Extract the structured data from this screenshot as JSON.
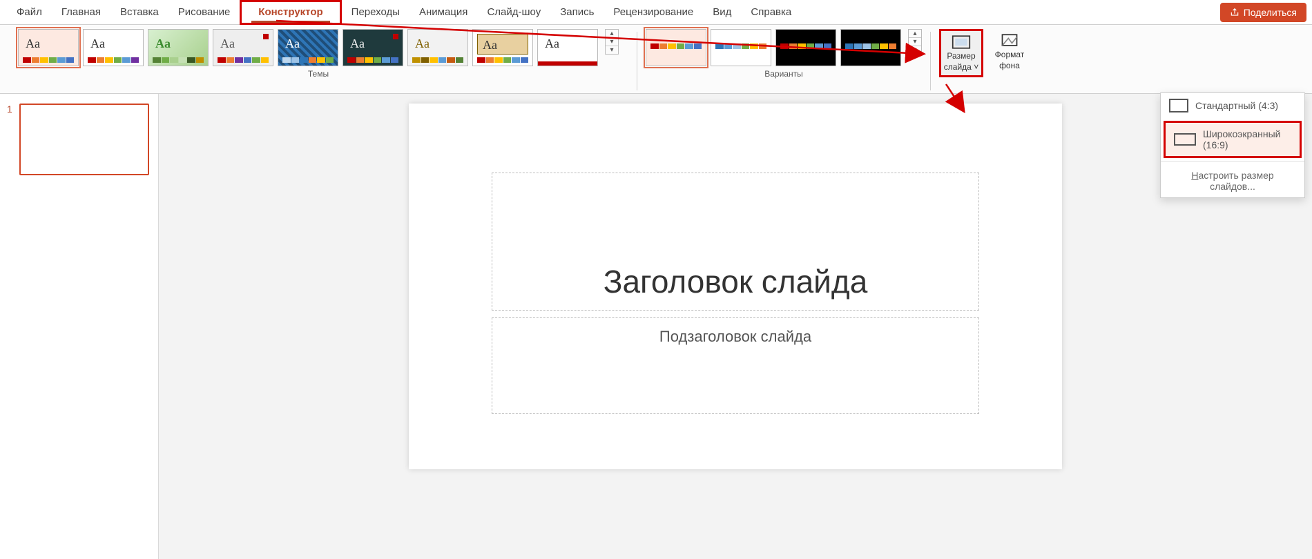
{
  "tabs": {
    "file": "Файл",
    "home": "Главная",
    "insert": "Вставка",
    "draw": "Рисование",
    "design": "Конструктор",
    "transitions": "Переходы",
    "animations": "Анимация",
    "slideshow": "Слайд-шоу",
    "record": "Запись",
    "review": "Рецензирование",
    "view": "Вид",
    "help": "Справка"
  },
  "share_label": "Поделиться",
  "ribbon": {
    "themes_label": "Темы",
    "variants_label": "Варианты",
    "slide_size_label_line1": "Размер",
    "slide_size_label_line2": "слайда",
    "format_bg_line1": "Формат",
    "format_bg_line2": "фона",
    "theme_sample_text": "Aa"
  },
  "menu": {
    "standard": "Стандартный (4:3)",
    "wide": "Широкоэкранный (16:9)",
    "custom_prefix": "Н",
    "custom_rest": "астроить размер слайдов..."
  },
  "thumbs": {
    "slide1_number": "1"
  },
  "slide": {
    "title_placeholder": "Заголовок слайда",
    "subtitle_placeholder": "Подзаголовок слайда"
  }
}
